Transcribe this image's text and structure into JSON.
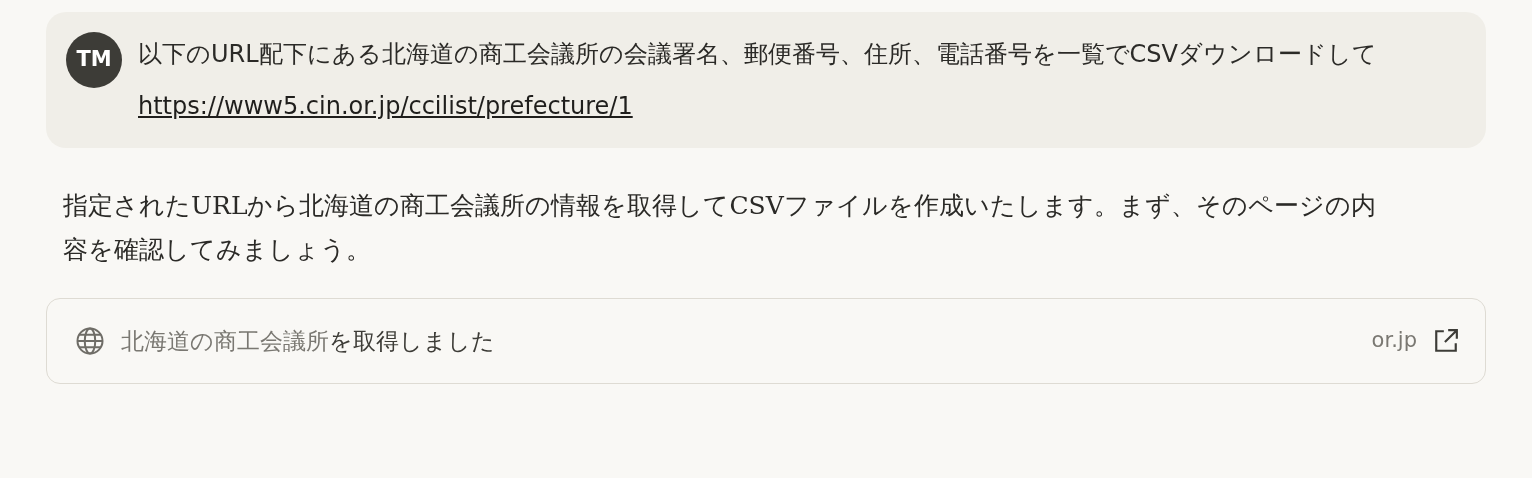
{
  "user_message": {
    "avatar": "TM",
    "text": "以下のURL配下にある北海道の商工会議所の会議署名、郵便番号、住所、電話番号を一覧でCSVダウンロードして",
    "link": "https://www5.cin.or.jp/ccilist/prefecture/1"
  },
  "assistant_message": {
    "text": "指定されたURLから北海道の商工会議所の情報を取得してCSVファイルを作成いたします。まず、そのページの内容を確認してみましょう。"
  },
  "fetch_result": {
    "page_title": "北海道の商工会議所",
    "status": "を取得しました",
    "domain": "or.jp"
  }
}
